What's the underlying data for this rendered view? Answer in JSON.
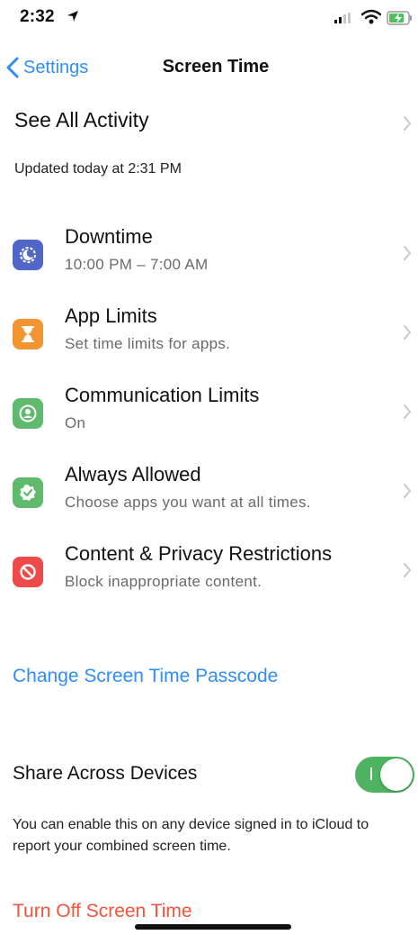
{
  "status_bar": {
    "time": "2:32"
  },
  "nav": {
    "back_label": "Settings",
    "title": "Screen Time"
  },
  "see_all": {
    "label": "See All Activity",
    "updated": "Updated today at 2:31 PM"
  },
  "rows": [
    {
      "title": "Downtime",
      "subtitle": "10:00 PM – 7:00 AM",
      "icon": "downtime-icon",
      "color": "#5166c9"
    },
    {
      "title": "App Limits",
      "subtitle": "Set time limits for apps.",
      "icon": "hourglass-icon",
      "color": "#f29432"
    },
    {
      "title": "Communication Limits",
      "subtitle": "On",
      "icon": "person-circle-icon",
      "color": "#5fba6e"
    },
    {
      "title": "Always Allowed",
      "subtitle": "Choose apps you want at all times.",
      "icon": "checkmark-badge-icon",
      "color": "#5fba6e"
    },
    {
      "title": "Content & Privacy Restrictions",
      "subtitle": "Block inappropriate content.",
      "icon": "no-entry-icon",
      "color": "#ee4a4a"
    }
  ],
  "passcode": {
    "label": "Change Screen Time Passcode"
  },
  "share": {
    "label": "Share Across Devices",
    "enabled": true,
    "note": "You can enable this on any device signed in to iCloud to report your combined screen time."
  },
  "turn_off": {
    "label": "Turn Off Screen Time"
  },
  "colors": {
    "accent": "#2f8ef4",
    "destructive": "#f0543c",
    "toggle_on": "#4fb461"
  }
}
